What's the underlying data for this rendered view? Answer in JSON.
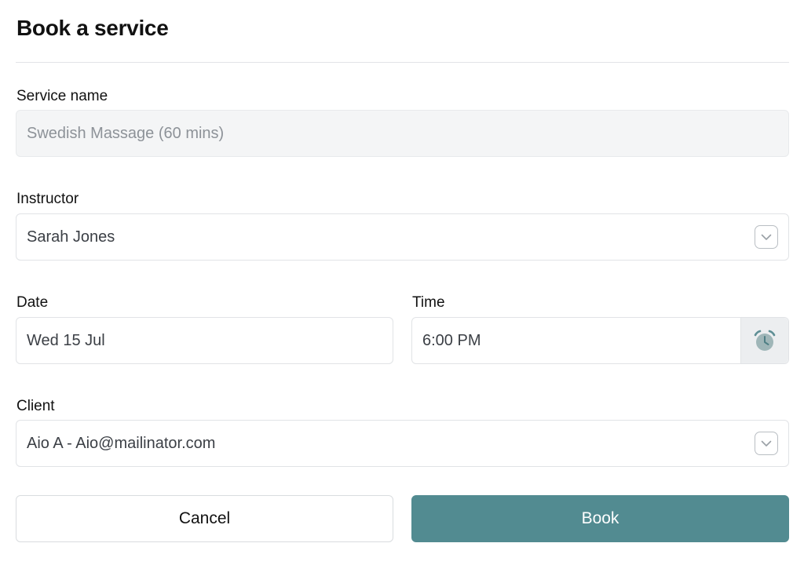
{
  "header": {
    "title": "Book a service"
  },
  "form": {
    "service": {
      "label": "Service name",
      "value": "Swedish Massage (60 mins)"
    },
    "instructor": {
      "label": "Instructor",
      "value": "Sarah Jones",
      "icon": "chevron-down-icon"
    },
    "date": {
      "label": "Date",
      "value": "Wed 15 Jul"
    },
    "time": {
      "label": "Time",
      "value": "6:00 PM",
      "icon": "alarm-clock-icon"
    },
    "client": {
      "label": "Client",
      "value": "Aio A - Aio@mailinator.com",
      "icon": "chevron-down-icon"
    }
  },
  "actions": {
    "cancel_label": "Cancel",
    "book_label": "Book"
  },
  "colors": {
    "accent": "#528b91",
    "disabled_bg": "#f4f5f6",
    "border": "#e1e3e6"
  }
}
